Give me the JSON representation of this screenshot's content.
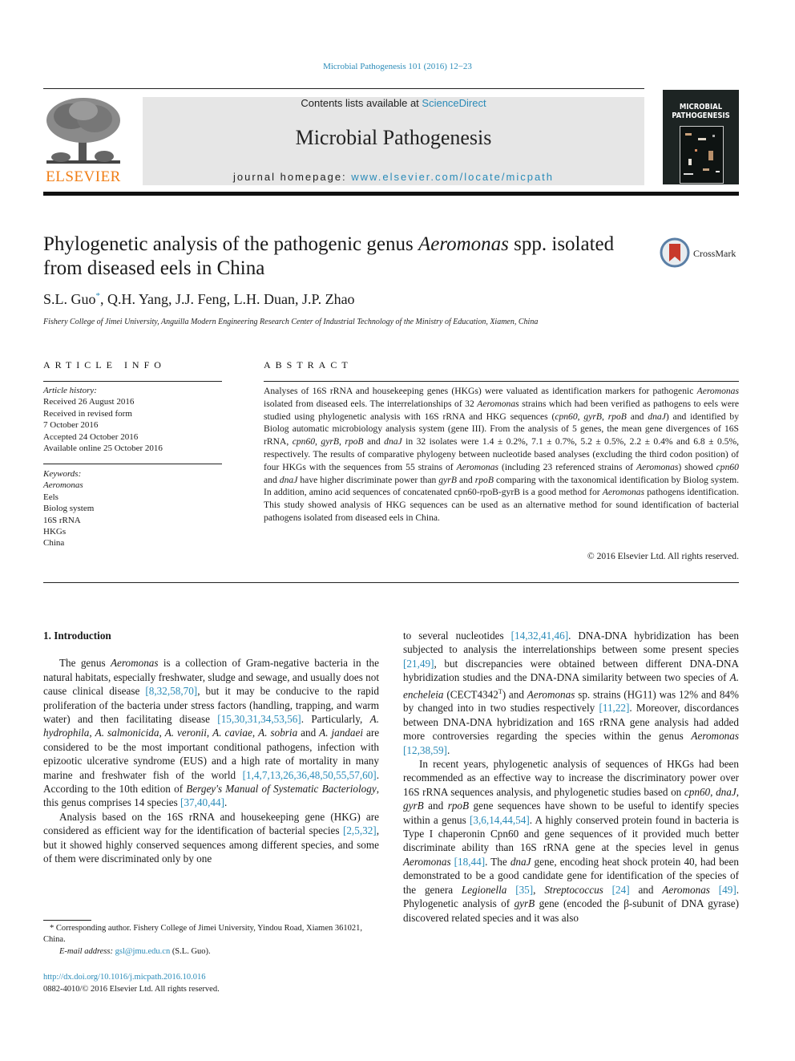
{
  "header": {
    "journal_ref": "Microbial Pathogenesis 101 (2016) 12−23",
    "contents_prefix": "Contents lists available at ",
    "contents_link": "ScienceDirect",
    "journal_name": "Microbial Pathogenesis",
    "homepage_prefix": "journal homepage: ",
    "homepage_link": "www.elsevier.com/locate/micpath",
    "publisher_logo_text": "ELSEVIER",
    "cover_title_line1": "MICROBIAL",
    "cover_title_line2": "PATHOGENESIS",
    "crossmark_label": "CrossMark"
  },
  "colors": {
    "link": "#2a8bb8",
    "elsevier_orange": "#f07d14",
    "banner_bg": "#e6e6e6",
    "crossmark_red": "#c8392b",
    "crossmark_ring": "#5a7fa6"
  },
  "article": {
    "title_part1": "Phylogenetic analysis of the pathogenic genus ",
    "title_italic": "Aeromonas",
    "title_part2": " spp. isolated from diseased eels in China",
    "authors": [
      {
        "name": "S.L. Guo",
        "mark": "*"
      },
      {
        "name": "Q.H. Yang"
      },
      {
        "name": "J.J. Feng"
      },
      {
        "name": "L.H. Duan"
      },
      {
        "name": "J.P. Zhao"
      }
    ],
    "affiliation": "Fishery College of Jimei University, Anguilla Modern Engineering Research Center of Industrial Technology of the Ministry of Education, Xiamen, China"
  },
  "article_info": {
    "heading": "ARTICLE INFO",
    "history_label": "Article history:",
    "history": [
      "Received 26 August 2016",
      "Received in revised form",
      "7 October 2016",
      "Accepted 24 October 2016",
      "Available online 25 October 2016"
    ],
    "keywords_label": "Keywords:",
    "keywords": [
      "Aeromonas",
      "Eels",
      "Biolog system",
      "16S rRNA",
      "HKGs",
      "China"
    ]
  },
  "abstract": {
    "heading": "ABSTRACT",
    "segments": [
      {
        "t": "Analyses of 16S rRNA and housekeeping genes (HKGs) were valuated as identification markers for pathogenic "
      },
      {
        "t": "Aeromonas",
        "i": true
      },
      {
        "t": " isolated from diseased eels. The interrelationships of 32 "
      },
      {
        "t": "Aeromonas",
        "i": true
      },
      {
        "t": " strains which had been verified as pathogens to eels were studied using phylogenetic analysis with 16S rRNA and HKG sequences ("
      },
      {
        "t": "cpn60",
        "i": true
      },
      {
        "t": ", "
      },
      {
        "t": "gyrB",
        "i": true
      },
      {
        "t": ", "
      },
      {
        "t": "rpoB",
        "i": true
      },
      {
        "t": " and "
      },
      {
        "t": "dnaJ",
        "i": true
      },
      {
        "t": ") and identified by Biolog automatic microbiology analysis system (gene III). From the analysis of 5 genes, the mean gene divergences of 16S rRNA, "
      },
      {
        "t": "cpn60",
        "i": true
      },
      {
        "t": ", "
      },
      {
        "t": "gyrB",
        "i": true
      },
      {
        "t": ", "
      },
      {
        "t": "rpoB",
        "i": true
      },
      {
        "t": " and "
      },
      {
        "t": "dnaJ",
        "i": true
      },
      {
        "t": " in 32 isolates were 1.4 ± 0.2%, 7.1 ± 0.7%, 5.2 ± 0.5%, 2.2 ± 0.4% and 6.8 ± 0.5%, respectively. The results of comparative phylogeny between nucleotide based analyses (excluding the third codon position) of four HKGs with the sequences from 55 strains of "
      },
      {
        "t": "Aeromonas",
        "i": true
      },
      {
        "t": " (including 23 referenced strains of "
      },
      {
        "t": "Aeromonas",
        "i": true
      },
      {
        "t": ") showed "
      },
      {
        "t": "cpn60",
        "i": true
      },
      {
        "t": " and "
      },
      {
        "t": "dnaJ",
        "i": true
      },
      {
        "t": " have higher discriminate power than "
      },
      {
        "t": "gyrB",
        "i": true
      },
      {
        "t": " and "
      },
      {
        "t": "rpoB",
        "i": true
      },
      {
        "t": " comparing with the taxonomical identification by Biolog system. In addition, amino acid sequences of concatenated cpn60-rpoB-gyrB is a good method for "
      },
      {
        "t": "Aeromonas",
        "i": true
      },
      {
        "t": " pathogens identification. This study showed analysis of HKG sequences can be used as an alternative method for sound identification of bacterial pathogens isolated from diseased eels in China."
      }
    ],
    "copyright": "© 2016 Elsevier Ltd. All rights reserved."
  },
  "body": {
    "intro_heading": "1.  Introduction",
    "left_paragraphs": [
      {
        "indent": true,
        "segments": [
          {
            "t": "The genus "
          },
          {
            "t": "Aeromonas",
            "i": true
          },
          {
            "t": " is a collection of Gram-negative bacteria in the natural habitats, especially freshwater, sludge and sewage, and usually does not cause clinical disease "
          },
          {
            "t": "[8,32,58,70]",
            "l": true
          },
          {
            "t": ", but it may be conducive to the rapid proliferation of the bacteria under stress factors (handling, trapping, and warm water) and then facilitating disease "
          },
          {
            "t": "[15,30,31,34,53,56]",
            "l": true
          },
          {
            "t": ". Particularly, "
          },
          {
            "t": "A. hydrophila",
            "i": true
          },
          {
            "t": ", "
          },
          {
            "t": "A. salmonicida",
            "i": true
          },
          {
            "t": ", "
          },
          {
            "t": "A. veronii",
            "i": true
          },
          {
            "t": ", "
          },
          {
            "t": "A. caviae",
            "i": true
          },
          {
            "t": ", "
          },
          {
            "t": "A. sobria",
            "i": true
          },
          {
            "t": " and "
          },
          {
            "t": "A. jandaei",
            "i": true
          },
          {
            "t": " are considered to be the most important conditional pathogens, infection with epizootic ulcerative syndrome (EUS) and a high rate of mortality in many marine and freshwater fish of the world "
          },
          {
            "t": "[1,4,7,13,26,36,48,50,55,57,60]",
            "l": true
          },
          {
            "t": ". According to the 10th edition of "
          },
          {
            "t": "Bergey's Manual of Systematic Bacteriology",
            "i": true
          },
          {
            "t": ", this genus comprises 14 species "
          },
          {
            "t": "[37,40,44]",
            "l": true
          },
          {
            "t": "."
          }
        ]
      },
      {
        "indent": true,
        "segments": [
          {
            "t": "Analysis based on the 16S rRNA and housekeeping gene (HKG) are considered as efficient way for the identification of bacterial species "
          },
          {
            "t": "[2,5,32]",
            "l": true
          },
          {
            "t": ", but it showed highly conserved sequences among different species, and some of them were discriminated only by one"
          }
        ]
      }
    ],
    "right_paragraphs": [
      {
        "indent": false,
        "segments": [
          {
            "t": "to several nucleotides "
          },
          {
            "t": "[14,32,41,46]",
            "l": true
          },
          {
            "t": ". DNA-DNA hybridization has been subjected to analysis the interrelationships between some present species "
          },
          {
            "t": "[21,49]",
            "l": true
          },
          {
            "t": ", but discrepancies were obtained between different DNA-DNA hybridization studies and the DNA-DNA similarity between two species of "
          },
          {
            "t": "A. encheleia",
            "i": true
          },
          {
            "t": " (CECT4342"
          },
          {
            "t": "T",
            "sup": true
          },
          {
            "t": ") and "
          },
          {
            "t": "Aeromonas",
            "i": true
          },
          {
            "t": " sp. strains (HG11) was 12% and 84% by changed into in two studies respectively "
          },
          {
            "t": "[11,22]",
            "l": true
          },
          {
            "t": ". Moreover, discordances between DNA-DNA hybridization and 16S rRNA gene analysis had added more controversies regarding the species within the genus "
          },
          {
            "t": "Aeromonas",
            "i": true
          },
          {
            "t": " "
          },
          {
            "t": "[12,38,59]",
            "l": true
          },
          {
            "t": "."
          }
        ]
      },
      {
        "indent": true,
        "segments": [
          {
            "t": "In recent years, phylogenetic analysis of sequences of HKGs had been recommended as an effective way to increase the discriminatory power over 16S rRNA sequences analysis, and phylogenetic studies based on "
          },
          {
            "t": "cpn60",
            "i": true
          },
          {
            "t": ", "
          },
          {
            "t": "dnaJ",
            "i": true
          },
          {
            "t": ", "
          },
          {
            "t": "gyrB",
            "i": true
          },
          {
            "t": " and "
          },
          {
            "t": "rpoB",
            "i": true
          },
          {
            "t": " gene sequences have shown to be useful to identify species within a genus "
          },
          {
            "t": "[3,6,14,44,54]",
            "l": true
          },
          {
            "t": ". A highly conserved protein found in bacteria is Type I chaperonin Cpn60 and gene sequences of it provided much better discriminate ability than 16S rRNA gene at the species level in genus "
          },
          {
            "t": "Aeromonas",
            "i": true
          },
          {
            "t": " "
          },
          {
            "t": "[18,44]",
            "l": true
          },
          {
            "t": ". The "
          },
          {
            "t": "dnaJ",
            "i": true
          },
          {
            "t": " gene, encoding heat shock protein 40, had been demonstrated to be a good candidate gene for identification of the species of the genera "
          },
          {
            "t": "Legionella",
            "i": true
          },
          {
            "t": " "
          },
          {
            "t": "[35]",
            "l": true
          },
          {
            "t": ", "
          },
          {
            "t": "Streptococcus",
            "i": true
          },
          {
            "t": " "
          },
          {
            "t": "[24]",
            "l": true
          },
          {
            "t": " and "
          },
          {
            "t": "Aeromonas",
            "i": true
          },
          {
            "t": " "
          },
          {
            "t": "[49]",
            "l": true
          },
          {
            "t": ". Phylogenetic analysis of "
          },
          {
            "t": "gyrB",
            "i": true
          },
          {
            "t": " gene (encoded the β-subunit of DNA gyrase) discovered related species and it was also"
          }
        ]
      }
    ]
  },
  "footnote": {
    "corresponding": "* Corresponding author. Fishery College of Jimei University, Yindou Road, Xiamen 361021, China.",
    "email_label": "E-mail address: ",
    "email": "gsl@jmu.edu.cn",
    "email_suffix": " (S.L. Guo).",
    "doi": "http://dx.doi.org/10.1016/j.micpath.2016.10.016",
    "issn": "0882-4010/© 2016 Elsevier Ltd. All rights reserved."
  }
}
